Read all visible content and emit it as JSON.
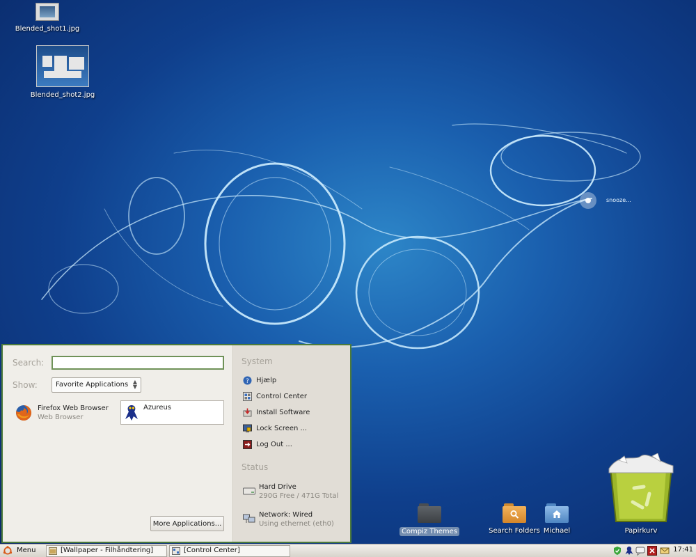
{
  "desktop": {
    "wallpaper_caption": "snooze...",
    "icons": [
      {
        "label": "Blended_shot1.jpg",
        "type": "image"
      },
      {
        "label": "Blended_shot2.jpg",
        "type": "image"
      },
      {
        "label": "Compiz Themes",
        "type": "folder"
      },
      {
        "label": "Search Folders",
        "type": "folder"
      },
      {
        "label": "Michael",
        "type": "folder"
      },
      {
        "label": "Papirkurv",
        "type": "trash"
      }
    ]
  },
  "menu": {
    "search_label": "Search:",
    "search_value": "",
    "show_label": "Show:",
    "show_selected": "Favorite Applications",
    "apps": [
      {
        "name": "Firefox Web Browser",
        "subtitle": "Web Browser",
        "icon": "firefox-icon"
      },
      {
        "name": "Azureus",
        "subtitle": "",
        "icon": "azureus-frog-icon"
      }
    ],
    "more_apps_label": "More Applications...",
    "system_heading": "System",
    "system_items": [
      {
        "label": "Hjælp",
        "icon": "help-icon"
      },
      {
        "label": "Control Center",
        "icon": "control-center-icon"
      },
      {
        "label": "Install Software",
        "icon": "install-software-icon"
      },
      {
        "label": "Lock Screen ...",
        "icon": "lock-screen-icon"
      },
      {
        "label": "Log Out ...",
        "icon": "log-out-icon"
      }
    ],
    "status_heading": "Status",
    "status_items": [
      {
        "title": "Hard Drive",
        "detail": "290G Free / 471G Total",
        "icon": "hard-drive-icon"
      },
      {
        "title": "Network: Wired",
        "detail": "Using ethernet (eth0)",
        "icon": "network-icon"
      }
    ]
  },
  "taskbar": {
    "menu_label": "Menu",
    "tasks": [
      {
        "label": "[Wallpaper - Filhåndtering]",
        "icon": "folder-icon"
      },
      {
        "label": "[Control Center]",
        "icon": "control-center-icon"
      }
    ],
    "clock": "17:41"
  },
  "colors": {
    "menu_border": "#4d7b3b",
    "desktop_blue": "#1a5fae",
    "heading_grey": "#a6a29a"
  }
}
